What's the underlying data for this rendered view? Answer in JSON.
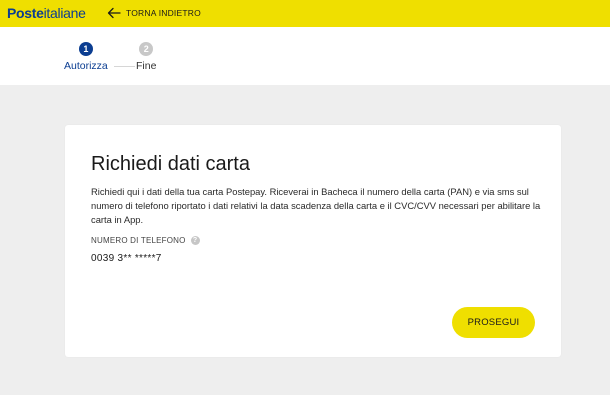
{
  "header": {
    "logo_bold": "Poste",
    "logo_regular": "italiane",
    "back_label": "TORNA INDIETRO",
    "back_icon": "arrow-left-icon",
    "background_color": "#efdf00",
    "brand_color": "#0b3d91"
  },
  "steps": [
    {
      "number": "1",
      "label": "Autorizza",
      "state": "active"
    },
    {
      "number": "2",
      "label": "Fine",
      "state": "inactive"
    }
  ],
  "card": {
    "title": "Richiedi dati carta",
    "description": "Richiedi qui i dati della tua carta Postepay. Riceverai in Bacheca il numero della carta (PAN) e via sms sul numero di telefono riportato i dati relativi la data scadenza della carta e il CVC/CVV necessari per abilitare la carta in App.",
    "phone_label": "NUMERO DI TELEFONO",
    "info_icon": "info-icon",
    "info_glyph": "?",
    "phone_value": "0039 3** *****7",
    "submit_label": "PROSEGUI"
  }
}
